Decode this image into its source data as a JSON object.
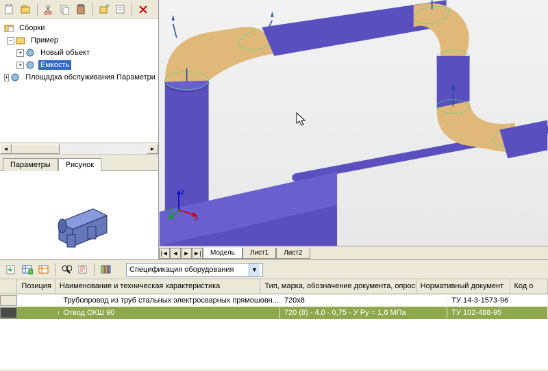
{
  "tree": {
    "root": "Сборки",
    "items": [
      {
        "label": "Пример",
        "expanded": true,
        "level": 1
      },
      {
        "label": "Новый объект",
        "level": 2,
        "hasChildren": true
      },
      {
        "label": "Емкость",
        "level": 2,
        "hasChildren": true,
        "selected": true
      },
      {
        "label": "Площадка обслуживания Параметри",
        "level": 2,
        "hasChildren": true
      }
    ]
  },
  "side_tabs": [
    {
      "label": "Параметры",
      "active": false
    },
    {
      "label": "Рисунок",
      "active": true
    }
  ],
  "view_tabs": [
    {
      "label": "Модель",
      "active": true
    },
    {
      "label": "Лист1",
      "active": false
    },
    {
      "label": "Лист2",
      "active": false
    }
  ],
  "axis": {
    "x": "x",
    "y": "y",
    "z": "z"
  },
  "spec": {
    "combo": "Спецификация оборудования",
    "columns": [
      "Позиция",
      "Наименование и техническая характеристика",
      "Тип, марка, обозначение документа, опросного листа",
      "Нормативный документ",
      "Код о"
    ],
    "rows": [
      {
        "pos": "",
        "name": "Трубопровод из труб стальных электросварных прямошовн...",
        "type": "720x8",
        "norm": "ТУ 14-3-1573-96",
        "selected": false
      },
      {
        "pos": "",
        "name": "Отвод ОКШ 90",
        "type": "720 (8) - 4,0 - 0,75 - У Ру = 1,6 МПа",
        "norm": "ТУ 102-488-95",
        "selected": true
      }
    ]
  }
}
